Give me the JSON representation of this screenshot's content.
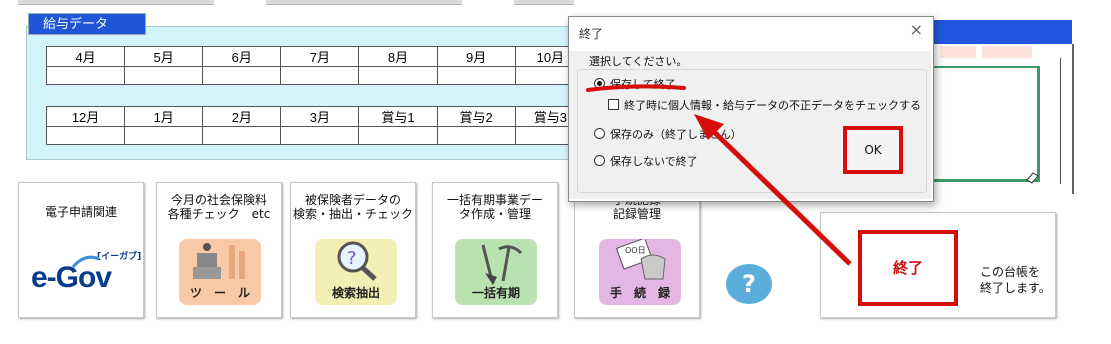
{
  "salary": {
    "title": "給与データ",
    "row1": [
      "4月",
      "5月",
      "6月",
      "7月",
      "8月",
      "9月",
      "10月"
    ],
    "row2": [
      "12月",
      "1月",
      "2月",
      "3月",
      "賞与1",
      "賞与2",
      "賞与3"
    ]
  },
  "buttons": {
    "egov": {
      "label": "電子申請関連",
      "logo": "e-Gov",
      "logo_sub": "[イーガブ]"
    },
    "tool": {
      "label_line1": "今月の社会保険料",
      "label_line2": "各種チェック　etc",
      "tile": "ツ　ー　ル"
    },
    "search": {
      "label_line1": "被保険者データの",
      "label_line2": "検索・抽出・チェック",
      "tile": "検索抽出"
    },
    "bulk": {
      "label_line1": "一括有期事業デー",
      "label_line2": "タ作成・管理",
      "tile": "一括有期"
    },
    "proc": {
      "label_line1": "手続記録",
      "label_line2": "記録管理",
      "tile": "手　続　録",
      "tile_small": "OO日"
    },
    "help": {
      "label": "?"
    },
    "exit": {
      "label": "終了",
      "desc_line1": "この台帳を",
      "desc_line2": "終了します。"
    }
  },
  "dialog": {
    "title": "終了",
    "close_glyph": "×",
    "prompt": "選択してください。",
    "options": {
      "save_exit": "保存して終了",
      "check_invalid": "終了時に個人情報・給与データの不正データをチェックする",
      "save_only": "保存のみ（終了しません）",
      "exit_nosave": "保存しないで終了"
    },
    "selected": "save_exit",
    "ok": "OK"
  },
  "colors": {
    "panel_bg": "#d2f5fb",
    "title_bg": "#1f55d6",
    "highlight_red": "#d60d0d",
    "help_blue": "#5aaed9"
  },
  "icons": [
    "close-icon",
    "radio-icon",
    "checkbox-icon",
    "arrow-annotation-icon",
    "person-tool-icon",
    "magnifier-icon",
    "shovel-pickaxe-icon",
    "hand-card-icon",
    "question-icon"
  ]
}
